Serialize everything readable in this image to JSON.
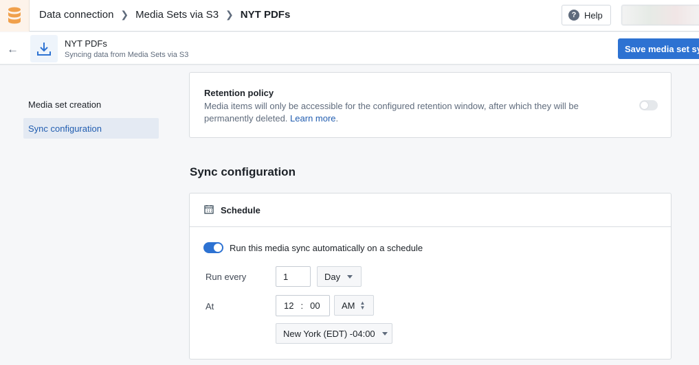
{
  "header": {
    "breadcrumbs": [
      "Data connection",
      "Media Sets via S3",
      "NYT PDFs"
    ],
    "help_label": "Help"
  },
  "subheader": {
    "title": "NYT PDFs",
    "description": "Syncing data from Media Sets via S3",
    "save_label": "Save media set sync"
  },
  "sidebar": {
    "items": [
      {
        "label": "Media set creation",
        "active": false
      },
      {
        "label": "Sync configuration",
        "active": true
      }
    ]
  },
  "retention": {
    "title": "Retention policy",
    "description": "Media items will only be accessible for the configured retention window, after which they will be permanently deleted.",
    "link": "Learn more",
    "enabled": false
  },
  "sync": {
    "heading": "Sync configuration",
    "schedule_title": "Schedule",
    "auto_label": "Run this media sync automatically on a schedule",
    "auto_enabled": true,
    "run_every_label": "Run every",
    "run_every_value": "1",
    "unit": "Day",
    "at_label": "At",
    "hour": "12",
    "colon": ":",
    "minute": "00",
    "ampm": "AM",
    "timezone": "New York (EDT) -04:00"
  },
  "colors": {
    "accent": "#2d72d2",
    "logo": "#f0a04b"
  }
}
